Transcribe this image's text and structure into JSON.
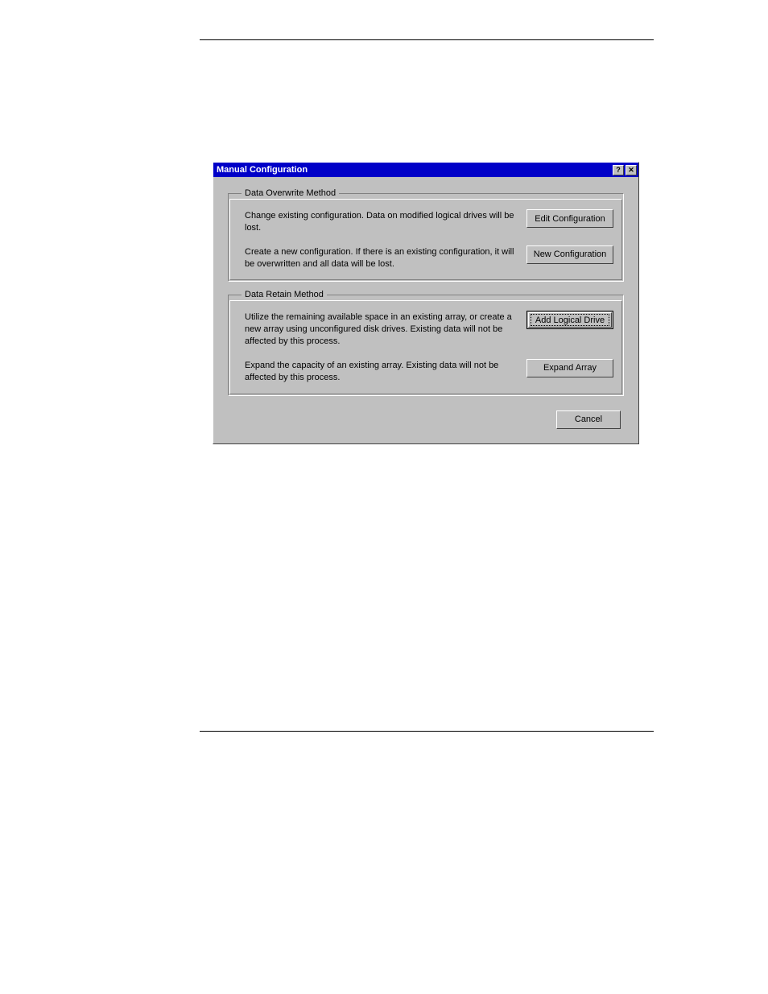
{
  "dialog": {
    "title": "Manual Configuration",
    "group1": {
      "legend": "Data Overwrite Method",
      "row1": {
        "text": "Change existing configuration. Data on  modified logical drives will be lost.",
        "button": "Edit Configuration"
      },
      "row2": {
        "text": "Create a new configuration. If there is an existing configuration, it will be overwritten and all data will be lost.",
        "button": "New Configuration"
      }
    },
    "group2": {
      "legend": "Data Retain Method",
      "row1": {
        "text": "Utilize the remaining available space in an existing array, or create a new array using unconfigured disk drives. Existing data will not be affected by this process.",
        "button": "Add Logical Drive"
      },
      "row2": {
        "text": "Expand the capacity of an existing array. Existing data will not be affected by this process.",
        "button": "Expand Array"
      }
    },
    "cancel": "Cancel",
    "help_glyph": "?",
    "close_glyph": "✕"
  }
}
